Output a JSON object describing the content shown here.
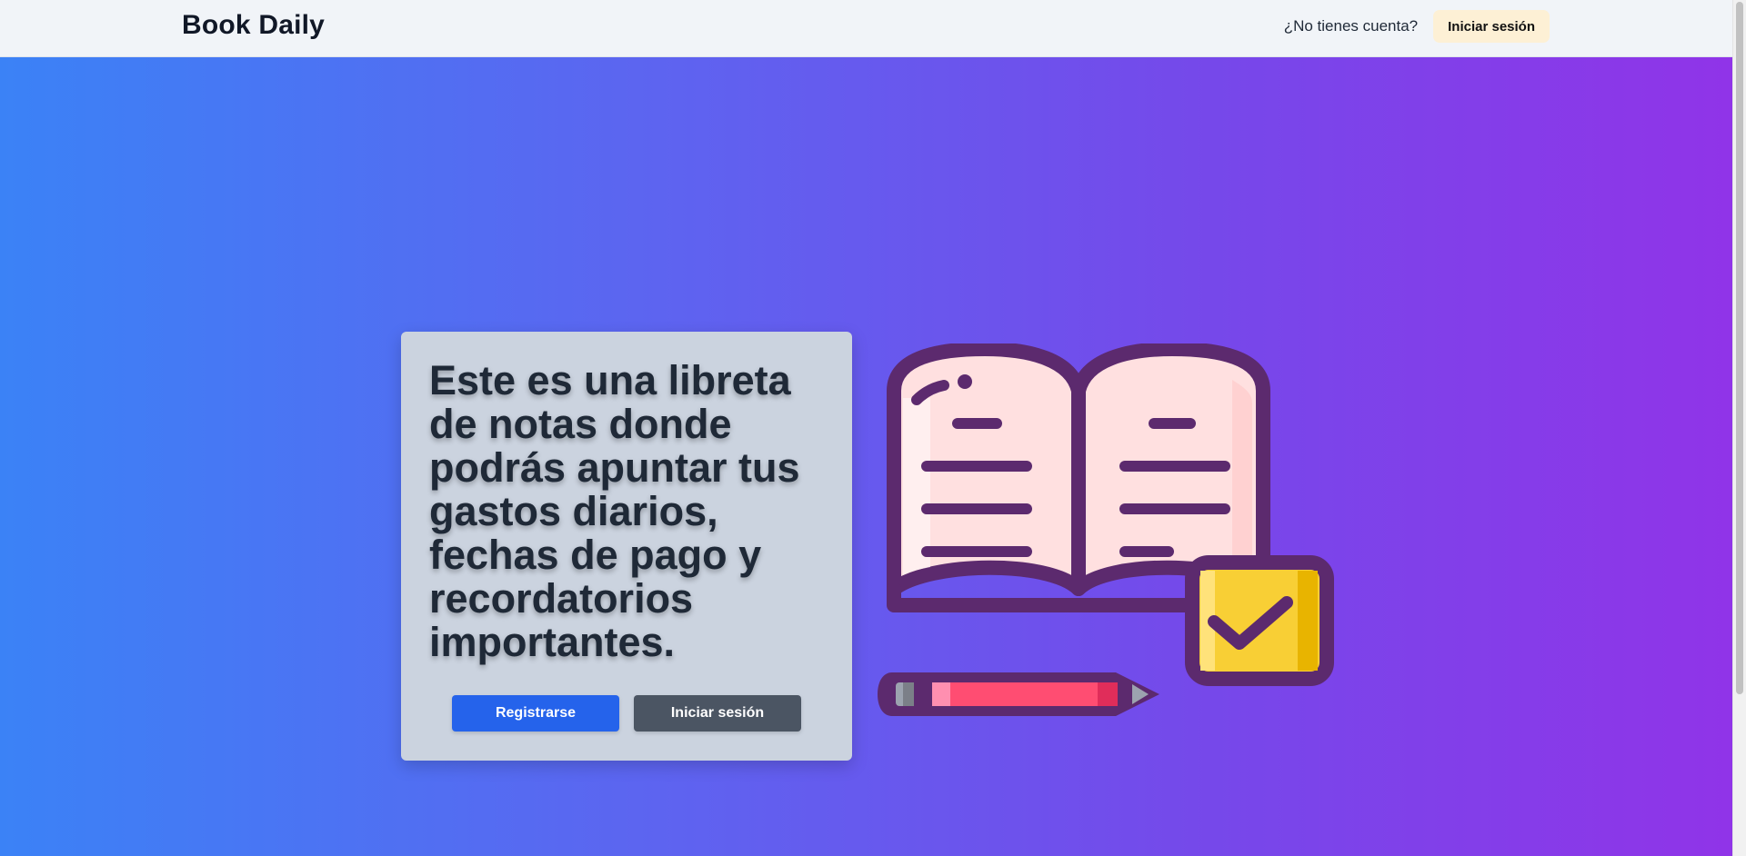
{
  "app": {
    "brand": "Book Daily"
  },
  "nav": {
    "question": "¿No tienes cuenta?",
    "login_label": "Iniciar sesión"
  },
  "hero": {
    "heading": "Este es una libreta de notas donde podrás apuntar tus gastos diarios, fechas de pago y recordatorios importantes.",
    "register_label": "Registrarse",
    "login_label": "Iniciar sesión",
    "illustration_icon": "open-book-pencil-checkbox-icon"
  },
  "colors": {
    "nav_bg": "#f1f4f8",
    "gradient_start": "#3b82f6",
    "gradient_end": "#9034e8",
    "card_bg": "#cbd3df",
    "register_button": "#2563eb",
    "login_button": "#4b5563",
    "nav_login_button": "#fdf0d5",
    "icon_outline": "#5c2a6e",
    "icon_page": "#ffe0e0",
    "icon_check_box": "#f8cf35",
    "icon_pencil": "#ff4d72"
  }
}
